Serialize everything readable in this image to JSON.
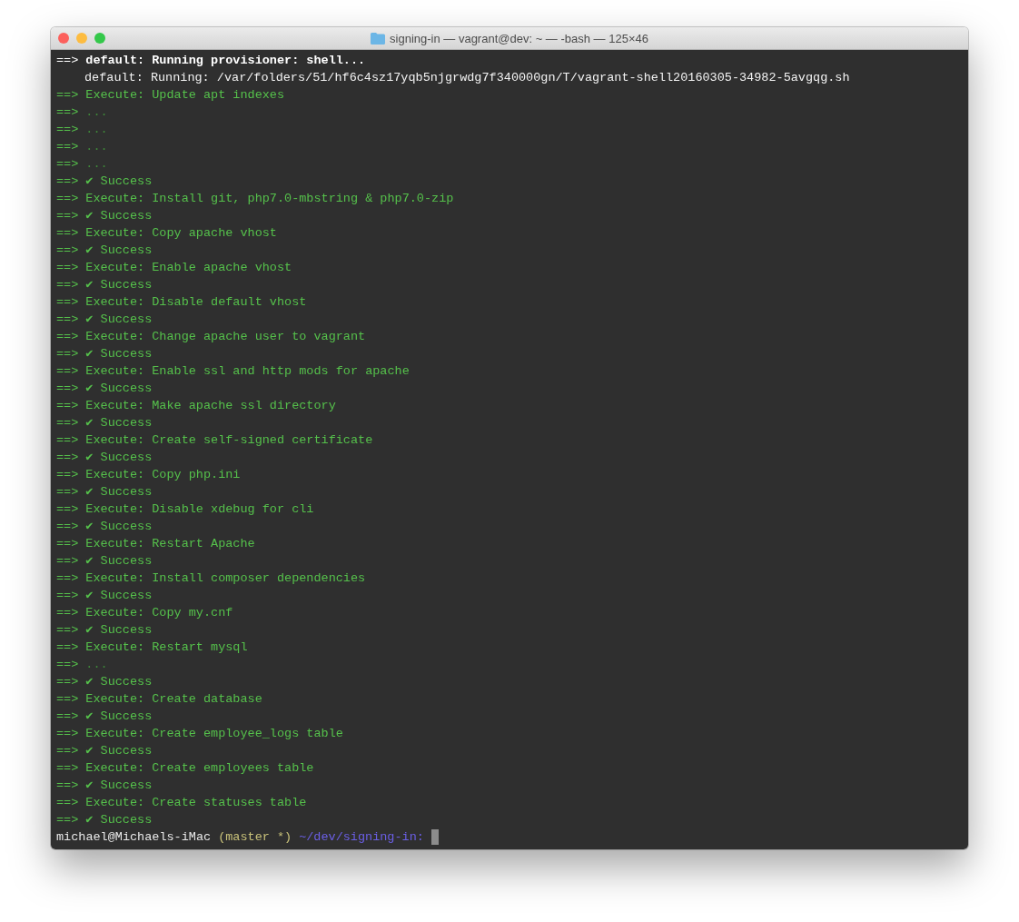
{
  "window": {
    "title": "signing-in — vagrant@dev: ~ — -bash — 125×46"
  },
  "lines": [
    {
      "kind": "header",
      "arrow": "==>",
      "text": "default: Running provisioner: shell..."
    },
    {
      "kind": "info",
      "text": "default: Running: /var/folders/51/hf6c4sz17yqb5njgrwdg7f340000gn/T/vagrant-shell20160305-34982-5avgqg.sh"
    },
    {
      "kind": "execute",
      "arrow": "==>",
      "text": "Execute: Update apt indexes"
    },
    {
      "kind": "dots",
      "arrow": "==>",
      "text": "..."
    },
    {
      "kind": "dots",
      "arrow": "==>",
      "text": "..."
    },
    {
      "kind": "dots",
      "arrow": "==>",
      "text": "..."
    },
    {
      "kind": "dots",
      "arrow": "==>",
      "text": "..."
    },
    {
      "kind": "success",
      "arrow": "==>",
      "text": "✔ Success"
    },
    {
      "kind": "execute",
      "arrow": "==>",
      "text": "Execute: Install git, php7.0-mbstring & php7.0-zip"
    },
    {
      "kind": "success",
      "arrow": "==>",
      "text": "✔ Success"
    },
    {
      "kind": "execute",
      "arrow": "==>",
      "text": "Execute: Copy apache vhost"
    },
    {
      "kind": "success",
      "arrow": "==>",
      "text": "✔ Success"
    },
    {
      "kind": "execute",
      "arrow": "==>",
      "text": "Execute: Enable apache vhost"
    },
    {
      "kind": "success",
      "arrow": "==>",
      "text": "✔ Success"
    },
    {
      "kind": "execute",
      "arrow": "==>",
      "text": "Execute: Disable default vhost"
    },
    {
      "kind": "success",
      "arrow": "==>",
      "text": "✔ Success"
    },
    {
      "kind": "execute",
      "arrow": "==>",
      "text": "Execute: Change apache user to vagrant"
    },
    {
      "kind": "success",
      "arrow": "==>",
      "text": "✔ Success"
    },
    {
      "kind": "execute",
      "arrow": "==>",
      "text": "Execute: Enable ssl and http mods for apache"
    },
    {
      "kind": "success",
      "arrow": "==>",
      "text": "✔ Success"
    },
    {
      "kind": "execute",
      "arrow": "==>",
      "text": "Execute: Make apache ssl directory"
    },
    {
      "kind": "success",
      "arrow": "==>",
      "text": "✔ Success"
    },
    {
      "kind": "execute",
      "arrow": "==>",
      "text": "Execute: Create self-signed certificate"
    },
    {
      "kind": "success",
      "arrow": "==>",
      "text": "✔ Success"
    },
    {
      "kind": "execute",
      "arrow": "==>",
      "text": "Execute: Copy php.ini"
    },
    {
      "kind": "success",
      "arrow": "==>",
      "text": "✔ Success"
    },
    {
      "kind": "execute",
      "arrow": "==>",
      "text": "Execute: Disable xdebug for cli"
    },
    {
      "kind": "success",
      "arrow": "==>",
      "text": "✔ Success"
    },
    {
      "kind": "execute",
      "arrow": "==>",
      "text": "Execute: Restart Apache"
    },
    {
      "kind": "success",
      "arrow": "==>",
      "text": "✔ Success"
    },
    {
      "kind": "execute",
      "arrow": "==>",
      "text": "Execute: Install composer dependencies"
    },
    {
      "kind": "success",
      "arrow": "==>",
      "text": "✔ Success"
    },
    {
      "kind": "execute",
      "arrow": "==>",
      "text": "Execute: Copy my.cnf"
    },
    {
      "kind": "success",
      "arrow": "==>",
      "text": "✔ Success"
    },
    {
      "kind": "execute",
      "arrow": "==>",
      "text": "Execute: Restart mysql"
    },
    {
      "kind": "dots",
      "arrow": "==>",
      "text": "..."
    },
    {
      "kind": "success",
      "arrow": "==>",
      "text": "✔ Success"
    },
    {
      "kind": "execute",
      "arrow": "==>",
      "text": "Execute: Create database"
    },
    {
      "kind": "success",
      "arrow": "==>",
      "text": "✔ Success"
    },
    {
      "kind": "execute",
      "arrow": "==>",
      "text": "Execute: Create employee_logs table"
    },
    {
      "kind": "success",
      "arrow": "==>",
      "text": "✔ Success"
    },
    {
      "kind": "execute",
      "arrow": "==>",
      "text": "Execute: Create employees table"
    },
    {
      "kind": "success",
      "arrow": "==>",
      "text": "✔ Success"
    },
    {
      "kind": "execute",
      "arrow": "==>",
      "text": "Execute: Create statuses table"
    },
    {
      "kind": "success",
      "arrow": "==>",
      "text": "✔ Success"
    }
  ],
  "prompt": {
    "user": "michael@Michaels-iMac",
    "branch": "(master *)",
    "path": "~/dev/signing-in:"
  }
}
